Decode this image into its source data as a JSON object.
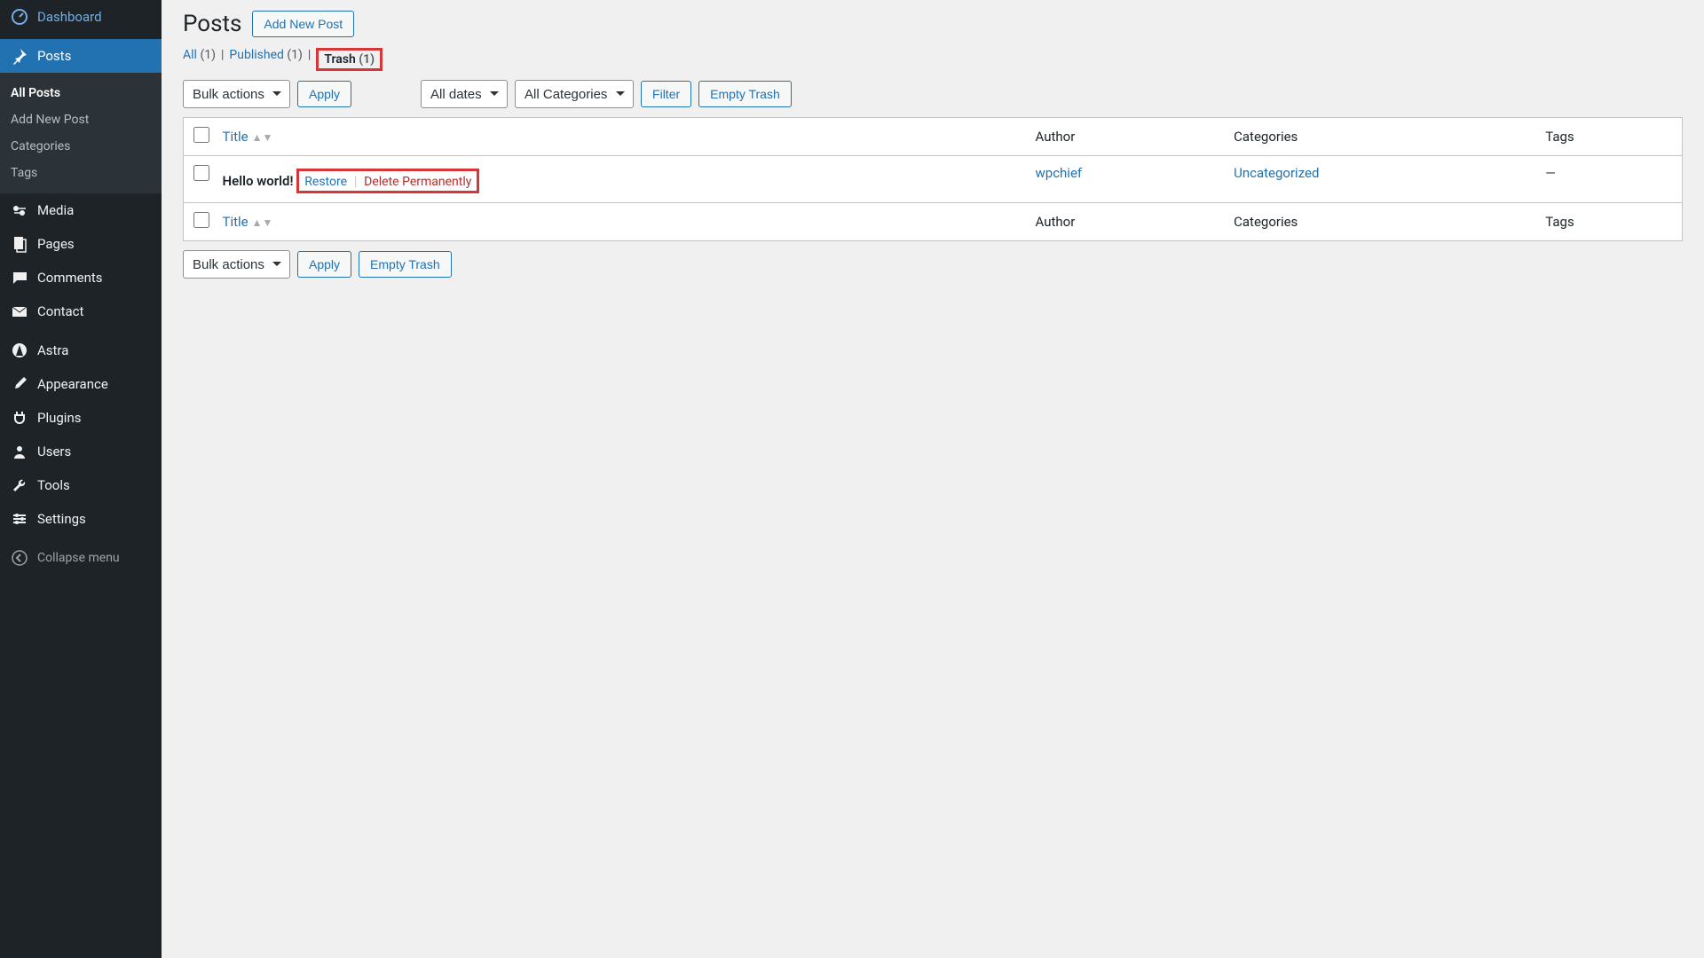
{
  "sidebar": {
    "items": [
      {
        "label": "Dashboard",
        "icon": "dashboard"
      },
      {
        "label": "Posts",
        "icon": "pin",
        "active": true,
        "submenu": [
          {
            "label": "All Posts",
            "current": true
          },
          {
            "label": "Add New Post"
          },
          {
            "label": "Categories"
          },
          {
            "label": "Tags"
          }
        ]
      },
      {
        "label": "Media",
        "icon": "media"
      },
      {
        "label": "Pages",
        "icon": "pages"
      },
      {
        "label": "Comments",
        "icon": "comments"
      },
      {
        "label": "Contact",
        "icon": "contact"
      },
      {
        "label": "Astra",
        "icon": "astra"
      },
      {
        "label": "Appearance",
        "icon": "appearance"
      },
      {
        "label": "Plugins",
        "icon": "plugins"
      },
      {
        "label": "Users",
        "icon": "users"
      },
      {
        "label": "Tools",
        "icon": "tools"
      },
      {
        "label": "Settings",
        "icon": "settings"
      }
    ],
    "collapse_label": "Collapse menu"
  },
  "header": {
    "title": "Posts",
    "add_new_label": "Add New Post"
  },
  "views": {
    "all": {
      "label": "All",
      "count": "(1)"
    },
    "published": {
      "label": "Published",
      "count": "(1)"
    },
    "trash": {
      "label": "Trash",
      "count": "(1)"
    }
  },
  "filters": {
    "bulk_actions": "Bulk actions",
    "apply": "Apply",
    "all_dates": "All dates",
    "all_categories": "All Categories",
    "filter": "Filter",
    "empty_trash": "Empty Trash"
  },
  "table": {
    "columns": {
      "title": "Title",
      "author": "Author",
      "categories": "Categories",
      "tags": "Tags"
    },
    "rows": [
      {
        "title": "Hello world!",
        "author": "wpchief",
        "category": "Uncategorized",
        "tags": "—",
        "actions": {
          "restore": "Restore",
          "delete": "Delete Permanently"
        }
      }
    ]
  }
}
